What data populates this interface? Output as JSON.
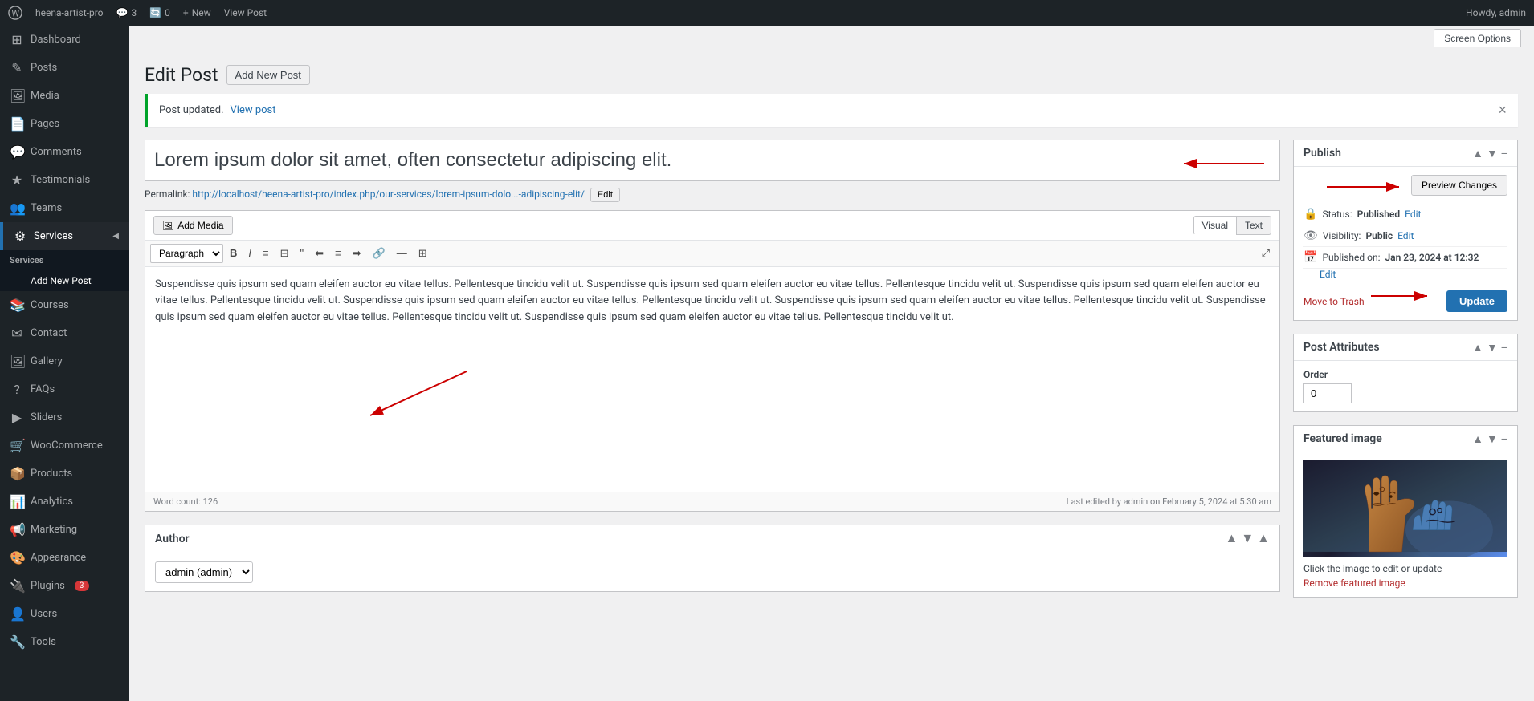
{
  "adminbar": {
    "site_name": "heena-artist-pro",
    "comments_count": "3",
    "updates_count": "0",
    "new_label": "New",
    "view_post_label": "View Post",
    "howdy": "Howdy, admin"
  },
  "screen_options": {
    "label": "Screen Options"
  },
  "page": {
    "title": "Edit Post",
    "add_new_label": "Add New Post"
  },
  "notice": {
    "text": "Post updated.",
    "link_text": "View post"
  },
  "post": {
    "title": "Lorem ipsum dolor sit amet, often consectetur adipiscing elit.",
    "permalink_base": "Permalink:",
    "permalink_url": "http://localhost/heena-artist-pro/index.php/our-services/lorem-ipsum-dolo...-adipiscing-elit/",
    "edit_label": "Edit",
    "content": "Suspendisse quis ipsum sed quam eleifen auctor eu vitae tellus. Pellentesque tincidu velit ut. Suspendisse quis ipsum sed quam eleifen auctor eu vitae tellus. Pellentesque tincidu velit ut. Suspendisse quis ipsum sed quam eleifen auctor eu vitae tellus. Pellentesque tincidu velit ut. Suspendisse quis ipsum sed quam eleifen auctor eu vitae tellus. Pellentesque tincidu velit ut. Suspendisse quis ipsum sed quam eleifen auctor eu vitae tellus. Pellentesque tincidu velit ut. Suspendisse quis ipsum sed quam eleifen auctor eu vitae tellus. Pellentesque tincidu velit ut. Suspendisse quis ipsum sed quam eleifen auctor eu vitae tellus. Pellentesque tincidu velit ut.",
    "word_count_label": "Word count:",
    "word_count": "126",
    "last_edited": "Last edited by admin on February 5, 2024 at 5:30 am"
  },
  "editor": {
    "paragraph_option": "Paragraph",
    "add_media_label": "Add Media",
    "visual_label": "Visual",
    "text_label": "Text"
  },
  "author_box": {
    "title": "Author",
    "selected": "admin (admin)"
  },
  "publish_box": {
    "title": "Publish",
    "preview_label": "Preview Changes",
    "status_label": "Status:",
    "status_value": "Published",
    "status_edit": "Edit",
    "visibility_label": "Visibility:",
    "visibility_value": "Public",
    "visibility_edit": "Edit",
    "published_label": "Published on:",
    "published_value": "Jan 23, 2024 at 12:32",
    "published_edit": "Edit",
    "move_to_trash": "Move to Trash",
    "update_label": "Update"
  },
  "post_attributes": {
    "title": "Post Attributes",
    "order_label": "Order",
    "order_value": "0"
  },
  "featured_image": {
    "title": "Featured image",
    "caption": "Click the image to edit or update",
    "remove_label": "Remove featured image"
  },
  "sidebar": {
    "items": [
      {
        "label": "Dashboard",
        "icon": "⊞"
      },
      {
        "label": "Posts",
        "icon": "✎"
      },
      {
        "label": "Media",
        "icon": "🖼"
      },
      {
        "label": "Pages",
        "icon": "📄"
      },
      {
        "label": "Comments",
        "icon": "💬"
      },
      {
        "label": "Testimonials",
        "icon": "★"
      },
      {
        "label": "Teams",
        "icon": "👥"
      },
      {
        "label": "Services",
        "icon": "⚙",
        "active": true
      },
      {
        "label": "Courses",
        "icon": "📚"
      },
      {
        "label": "Contact",
        "icon": "✉"
      },
      {
        "label": "Gallery",
        "icon": "🖼"
      },
      {
        "label": "FAQs",
        "icon": "?"
      },
      {
        "label": "Sliders",
        "icon": "▶"
      },
      {
        "label": "WooCommerce",
        "icon": "🛒"
      },
      {
        "label": "Products",
        "icon": "📦"
      },
      {
        "label": "Analytics",
        "icon": "📊"
      },
      {
        "label": "Marketing",
        "icon": "📢"
      },
      {
        "label": "Appearance",
        "icon": "🎨"
      },
      {
        "label": "Plugins",
        "icon": "🔌",
        "badge": "3"
      },
      {
        "label": "Users",
        "icon": "👤"
      },
      {
        "label": "Tools",
        "icon": "🔧"
      }
    ],
    "services_submenu": {
      "label": "Services",
      "add_new": "Add New Post"
    }
  }
}
